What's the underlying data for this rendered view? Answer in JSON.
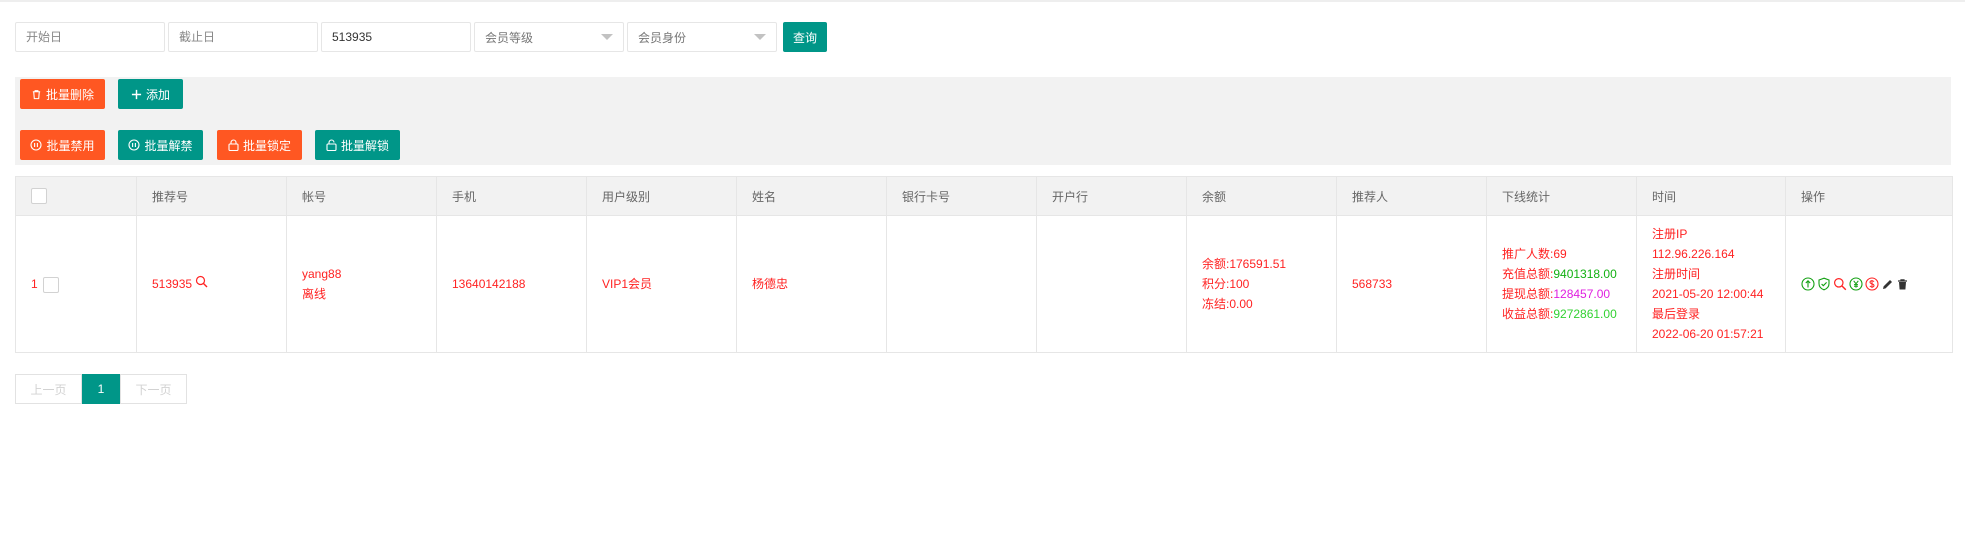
{
  "search": {
    "start_date_placeholder": "开始日",
    "end_date_placeholder": "截止日",
    "keyword_value": "513935",
    "member_level_label": "会员等级",
    "member_identity_label": "会员身份",
    "query_label": "查询"
  },
  "toolbar": {
    "batch_delete": "批量删除",
    "add": "添加",
    "batch_disable": "批量禁用",
    "batch_unban": "批量解禁",
    "batch_lock": "批量锁定",
    "batch_unlock": "批量解锁"
  },
  "table": {
    "headers": [
      "推荐号",
      "帐号",
      "手机",
      "用户级别",
      "姓名",
      "银行卡号",
      "开户行",
      "余额",
      "推荐人",
      "下线统计",
      "时间",
      "操作"
    ],
    "rows": [
      {
        "index": "1",
        "referral_no": "513935",
        "account": "yang88",
        "online_status": "离线",
        "phone": "13640142188",
        "level": "VIP1会员",
        "name": "杨德忠",
        "bank_card": "",
        "bank": "",
        "balance_line": "余额:176591.51",
        "points_line": "积分:100",
        "frozen_line": "冻结:0.00",
        "referrer": "568733",
        "downline_count_line": "推广人数:69",
        "recharge_label": "充值总额:",
        "recharge_value": "9401318.00",
        "withdraw_label": "提现总额:",
        "withdraw_value": "128457.00",
        "income_label": "收益总额:",
        "income_value": "9272861.00",
        "reg_ip_label": "注册IP",
        "reg_ip": "112.96.226.164",
        "reg_time_label": "注册时间",
        "reg_time": "2021-05-20 12:00:44",
        "last_login_label": "最后登录",
        "last_login": "2022-06-20 01:57:21"
      }
    ]
  },
  "pager": {
    "prev": "上一页",
    "current": "1",
    "next": "下一页"
  },
  "colors": {
    "teal": "#009688",
    "red": "#ff5722",
    "text_red": "#ff2222",
    "green": "#12b012",
    "magenta": "#e020e0",
    "lime": "#32d132"
  }
}
